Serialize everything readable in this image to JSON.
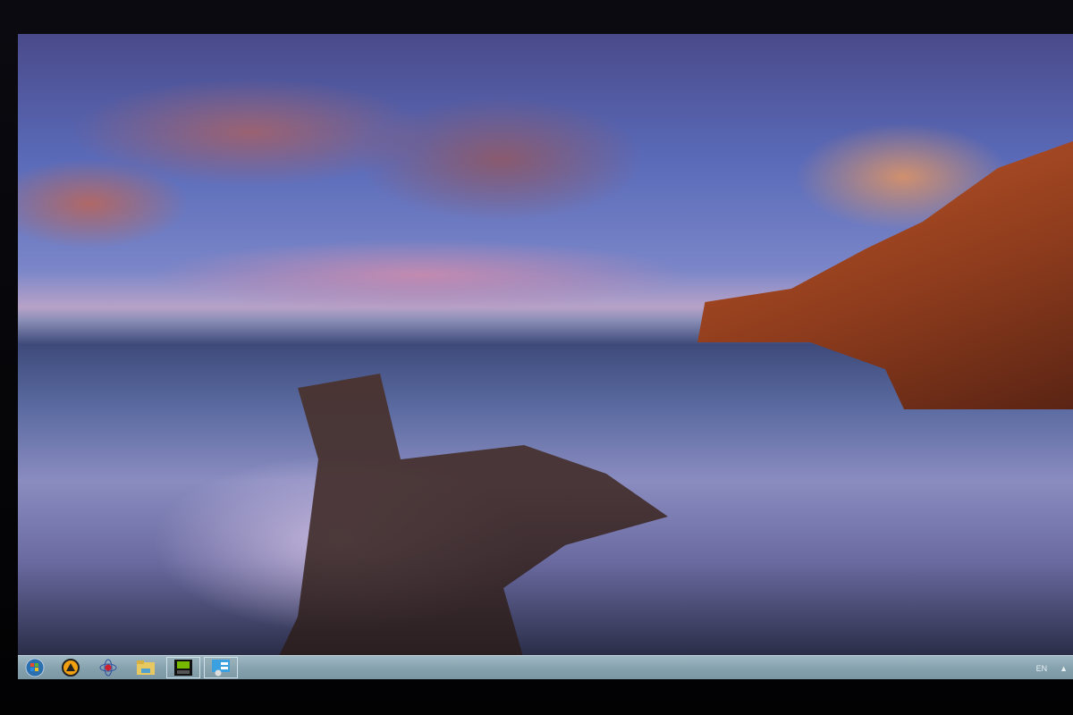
{
  "taskbar": {
    "items": [
      {
        "icon": "windows-start-orb-icon"
      },
      {
        "icon": "aimp-player-icon"
      },
      {
        "icon": "media-player-classic-icon"
      },
      {
        "icon": "file-explorer-folder-icon"
      },
      {
        "icon": "nvidia-control-panel-icon"
      },
      {
        "icon": "control-panel-icon"
      }
    ],
    "tray": {
      "language": "EN",
      "show_hidden_icon": "▲"
    }
  },
  "colors": {
    "taskbar": "#86a2ae",
    "accent": "#c2582a"
  }
}
